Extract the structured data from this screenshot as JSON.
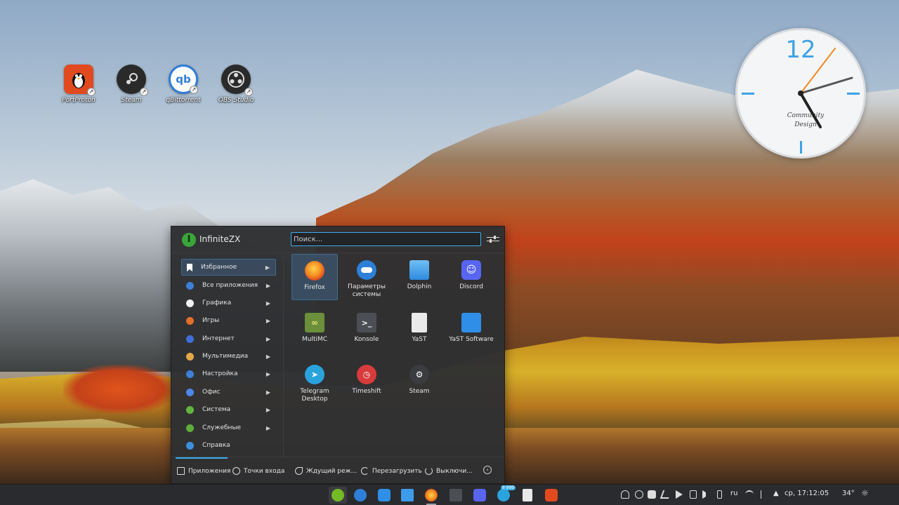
{
  "desktop": {
    "icons": [
      {
        "label": "PortProton",
        "icon": "penguin-icon",
        "color": "#e14a1e"
      },
      {
        "label": "Steam",
        "icon": "steam-icon",
        "color": "#2a2a2a"
      },
      {
        "label": "qBittorrent",
        "icon": "qbittorrent-icon",
        "color": "#2f7ed8"
      },
      {
        "label": "OBS Studio",
        "icon": "obs-icon",
        "color": "#2a2a2a"
      }
    ]
  },
  "clock": {
    "twelve": "12",
    "brand_line1": "Community",
    "brand_line2": "Design",
    "accent": "#3da2e6"
  },
  "launcher": {
    "username": "InfiniteZX",
    "avatar_letter": "I",
    "search_placeholder": "Поиск...",
    "categories": [
      {
        "label": "Избранное",
        "color": "#ffffff",
        "has_arrow": true,
        "active": true
      },
      {
        "label": "Все приложения",
        "color": "#3d7fd9",
        "has_arrow": true
      },
      {
        "label": "Графика",
        "color": "#f0f0f0",
        "has_arrow": true
      },
      {
        "label": "Игры",
        "color": "#e0702a",
        "has_arrow": true
      },
      {
        "label": "Интернет",
        "color": "#3d6fd9",
        "has_arrow": true
      },
      {
        "label": "Мультимедиа",
        "color": "#e2a74a",
        "has_arrow": true
      },
      {
        "label": "Настройка",
        "color": "#3d7fd9",
        "has_arrow": true
      },
      {
        "label": "Офис",
        "color": "#4c86e8",
        "has_arrow": true
      },
      {
        "label": "Система",
        "color": "#62b63f",
        "has_arrow": true
      },
      {
        "label": "Служебные",
        "color": "#5fae3b",
        "has_arrow": true
      },
      {
        "label": "Справка",
        "color": "#3d8fe0",
        "has_arrow": false
      }
    ],
    "apps": [
      {
        "label": "Firefox",
        "icon": "firefox-icon",
        "color": "#f36d22",
        "active": true
      },
      {
        "label": "Параметры системы",
        "icon": "settings-icon",
        "color": "#2d7fd8"
      },
      {
        "label": "Dolphin",
        "icon": "folder-icon",
        "color": "#3d9be9"
      },
      {
        "label": "Discord",
        "icon": "discord-icon",
        "color": "#5865f2"
      },
      {
        "label": "MultiMC",
        "icon": "multimc-icon",
        "color": "#6b8f3a"
      },
      {
        "label": "Konsole",
        "icon": "terminal-icon",
        "color": "#4b4f55"
      },
      {
        "label": "YaST",
        "icon": "yast-icon",
        "color": "#e9e9e9"
      },
      {
        "label": "YaST Software",
        "icon": "bag-icon",
        "color": "#2f8fe8"
      },
      {
        "label": "Telegram Desktop",
        "icon": "telegram-icon",
        "color": "#2aa3dd"
      },
      {
        "label": "Timeshift",
        "icon": "timeshift-icon",
        "color": "#d83b3b"
      },
      {
        "label": "Steam",
        "icon": "steam-icon",
        "color": "#3a3c40"
      }
    ],
    "footer": {
      "applications": "Приложения",
      "places": "Точки входа",
      "sleep": "Ждущий реж...",
      "restart": "Перезагрузить",
      "shutdown": "Выключи..."
    }
  },
  "panel": {
    "tasks": [
      {
        "name": "opensuse-icon",
        "color": "#73ba25",
        "running": false
      },
      {
        "name": "settings-icon",
        "color": "#2d7fd8",
        "running": false
      },
      {
        "name": "discover-icon",
        "color": "#2f8fe8",
        "running": false
      },
      {
        "name": "dolphin-icon",
        "color": "#3d9be9",
        "running": false
      },
      {
        "name": "firefox-icon",
        "color": "#f36d22",
        "running": true
      },
      {
        "name": "konsole-icon",
        "color": "#4b4f55",
        "running": false
      },
      {
        "name": "discord-icon",
        "color": "#5865f2",
        "running": false
      },
      {
        "name": "telegram-icon",
        "color": "#2aa3dd",
        "running": false,
        "badge": "9 999"
      },
      {
        "name": "notes-icon",
        "color": "#e8e8e8",
        "running": false
      },
      {
        "name": "portproton-icon",
        "color": "#e14a1e",
        "running": false
      }
    ],
    "tray": {
      "keyboard_layout": "ru",
      "datetime": "ср, 17:12:05",
      "temperature": "34°"
    }
  }
}
